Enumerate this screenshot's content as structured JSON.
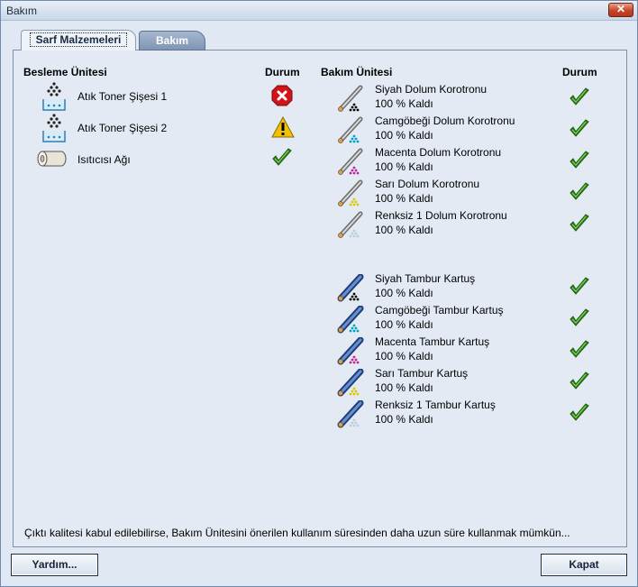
{
  "window": {
    "title": "Bakım",
    "close_glyph": "✕"
  },
  "tabs": [
    {
      "label": "Sarf Malzemeleri",
      "active": true
    },
    {
      "label": "Bakım",
      "active": false
    }
  ],
  "left": {
    "header": "Besleme Ünitesi",
    "status_header": "Durum",
    "items": [
      {
        "label": "Atık Toner Şişesi 1",
        "icon": "waste-toner-bottle-icon",
        "status": "error"
      },
      {
        "label": "Atık Toner Şişesi 2",
        "icon": "waste-toner-bottle-icon",
        "status": "warning"
      },
      {
        "label": "Isıtıcısı Ağı",
        "icon": "fuser-web-icon",
        "status": "ok"
      }
    ]
  },
  "right": {
    "header": "Bakım Ünitesi",
    "status_header": "Durum",
    "corotrons": [
      {
        "name": "Siyah Dolum Korotronu",
        "remaining": "100 % Kaldı",
        "color": "#000000",
        "status": "ok"
      },
      {
        "name": "Camgöbeği Dolum Korotronu",
        "remaining": "100 % Kaldı",
        "color": "#00a3c4",
        "status": "ok"
      },
      {
        "name": "Macenta Dolum Korotronu",
        "remaining": "100 % Kaldı",
        "color": "#c0249b",
        "status": "ok"
      },
      {
        "name": "Sarı Dolum Korotronu",
        "remaining": "100 % Kaldı",
        "color": "#d8c800",
        "status": "ok"
      },
      {
        "name": "Renksiz 1 Dolum Korotronu",
        "remaining": "100 % Kaldı",
        "color": "#b8cde0",
        "status": "ok"
      }
    ],
    "drums": [
      {
        "name": "Siyah Tambur Kartuş",
        "remaining": "100 % Kaldı",
        "color": "#000000",
        "status": "ok"
      },
      {
        "name": "Camgöbeği Tambur Kartuş",
        "remaining": "100 % Kaldı",
        "color": "#00a3c4",
        "status": "ok"
      },
      {
        "name": "Macenta Tambur Kartuş",
        "remaining": "100 % Kaldı",
        "color": "#c0249b",
        "status": "ok"
      },
      {
        "name": "Sarı Tambur Kartuş",
        "remaining": "100 % Kaldı",
        "color": "#d8c800",
        "status": "ok"
      },
      {
        "name": "Renksiz 1 Tambur Kartuş",
        "remaining": "100 % Kaldı",
        "color": "#b8cde0",
        "status": "ok"
      }
    ]
  },
  "footnote": "Çıktı kalitesi kabul edilebilirse, Bakım Ünitesini önerilen kullanım süresinden daha uzun süre kullanmak mümkün...",
  "buttons": {
    "help": "Yardım...",
    "close": "Kapat"
  },
  "colors": {
    "ok": "#2f8a18",
    "error": "#d0141a",
    "warning": "#f2c200"
  }
}
